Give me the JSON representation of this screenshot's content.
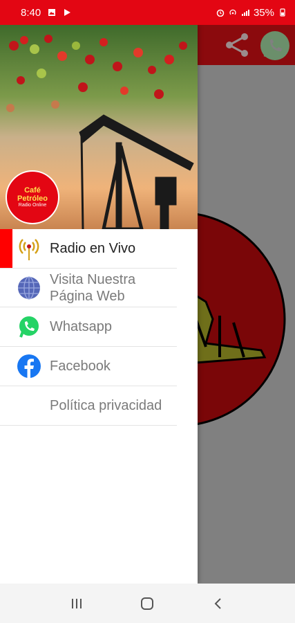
{
  "status_bar": {
    "time": "8:40",
    "battery": "35%",
    "left_icons": [
      "image-icon",
      "play-icon"
    ],
    "right_icons": [
      "alarm-icon",
      "hotspot-icon",
      "signal-icon",
      "battery-icon"
    ],
    "color": "#e30613"
  },
  "drawer": {
    "brand": {
      "line1": "Café",
      "line2": "Petróleo",
      "line3": "Radio Online"
    },
    "items": [
      {
        "label": "Radio en Vivo",
        "icon": "radio-antenna-icon",
        "active": true
      },
      {
        "label": "Visita Nuestra Página Web",
        "icon": "globe-icon",
        "active": false
      },
      {
        "label": "Whatsapp",
        "icon": "whatsapp-icon",
        "active": false
      },
      {
        "label": "Facebook",
        "icon": "facebook-icon",
        "active": false
      },
      {
        "label": "Política privacidad",
        "icon": "",
        "active": false
      }
    ]
  },
  "colors": {
    "accent": "#ff0000",
    "toolbar": "#8b0a0d",
    "overlay": "#808080",
    "whatsapp": "#25d366",
    "facebook": "#1877f2"
  }
}
